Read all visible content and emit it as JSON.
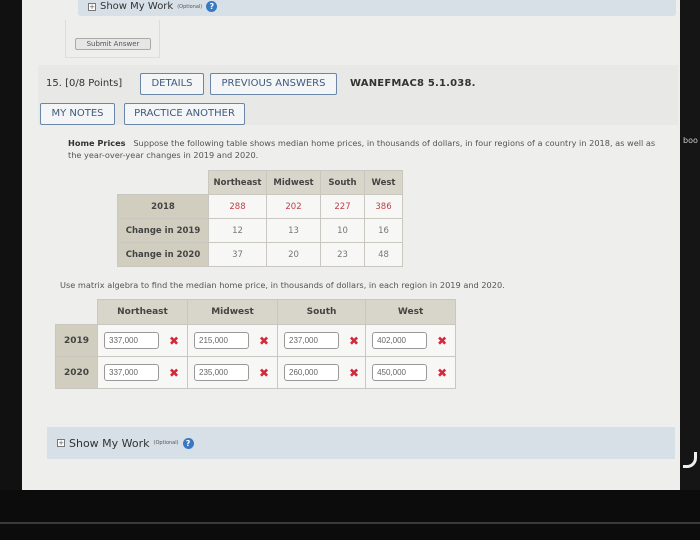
{
  "top_work": {
    "label": "Show My Work",
    "optional": "(Optional)",
    "help": "?"
  },
  "submit_button": "Submit Answer",
  "question": {
    "number": "15.",
    "points": "[0/8 Points]",
    "buttons": {
      "details": "DETAILS",
      "previous_answers": "PREVIOUS ANSWERS",
      "my_notes": "MY NOTES",
      "practice_another": "PRACTICE ANOTHER"
    },
    "code": "WANEFMAC8 5.1.038."
  },
  "prompt": {
    "title": "Home Prices",
    "text": "Suppose the following table shows median home prices, in thousands of dollars, in four regions of a country in 2018, as well as the year-over-year changes in 2019 and 2020."
  },
  "given_table": {
    "columns": [
      "Northeast",
      "Midwest",
      "South",
      "West"
    ],
    "rows": [
      {
        "label": "2018",
        "values": [
          "288",
          "202",
          "227",
          "386"
        ]
      },
      {
        "label": "Change in 2019",
        "values": [
          "12",
          "13",
          "10",
          "16"
        ]
      },
      {
        "label": "Change in 2020",
        "values": [
          "37",
          "20",
          "23",
          "48"
        ]
      }
    ]
  },
  "instruction": "Use matrix algebra to find the median home price, in thousands of dollars, in each region in 2019 and 2020.",
  "answer_table": {
    "columns": [
      "Northeast",
      "Midwest",
      "South",
      "West"
    ],
    "rows": [
      {
        "label": "2019",
        "values": [
          "337,000",
          "215,000",
          "237,000",
          "402,000"
        ],
        "status": [
          "incorrect",
          "incorrect",
          "incorrect",
          "incorrect"
        ]
      },
      {
        "label": "2020",
        "values": [
          "337,000",
          "235,000",
          "260,000",
          "450,000"
        ],
        "status": [
          "incorrect",
          "incorrect",
          "incorrect",
          "incorrect"
        ]
      }
    ],
    "incorrect_mark": "✖"
  },
  "bottom_work": {
    "label": "Show My Work",
    "optional": "(Optional)",
    "help": "?"
  },
  "edge_text": "boo",
  "colors": {
    "button_border": "#6a86a8",
    "incorrect": "#d4283c",
    "given_2018": "#c0404a",
    "work_panel": "#d6e0e6"
  }
}
